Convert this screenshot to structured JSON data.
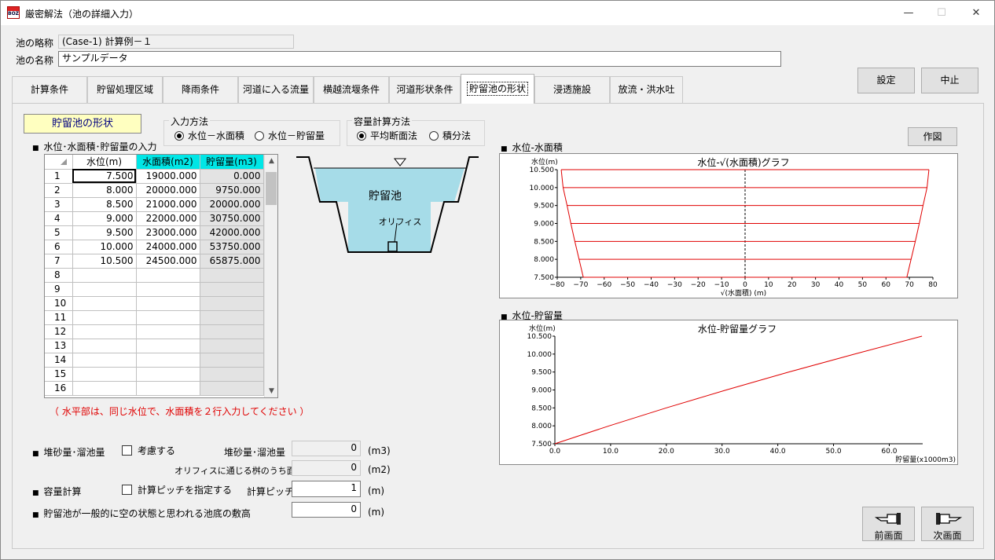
{
  "window": {
    "title": "厳密解法（池の詳細入力）",
    "app_icon_text": "BOZ",
    "minimize": "—",
    "maximize": "☐",
    "close": "✕"
  },
  "header": {
    "abbr_label": "池の略称",
    "abbr_value": "(Case-1) 計算例－１",
    "name_label": "池の名称",
    "name_value": "サンプルデータ",
    "settings_button": "設定",
    "cancel_button": "中止"
  },
  "tabs": [
    "計算条件",
    "貯留処理区域",
    "降雨条件",
    "河道に入る流量",
    "横越流堰条件",
    "河道形状条件",
    "貯留池の形状",
    "浸透施設",
    "放流・洪水吐"
  ],
  "active_tab": 6,
  "panel": {
    "section_label": "貯留池の形状",
    "input_method": {
      "title": "入力方法",
      "options": [
        "水位－水面積",
        "水位－貯留量"
      ],
      "selected": 0
    },
    "capacity_method": {
      "title": "容量計算方法",
      "options": [
        "平均断面法",
        "積分法"
      ],
      "selected": 0
    },
    "table_section": "水位･水面積･貯留量の入力",
    "table": {
      "headers": [
        "水位(m)",
        "水面積(m2)",
        "貯留量(m3)"
      ],
      "rows": [
        [
          "1",
          "7.500",
          "19000.000",
          "0.000"
        ],
        [
          "2",
          "8.000",
          "20000.000",
          "9750.000"
        ],
        [
          "3",
          "8.500",
          "21000.000",
          "20000.000"
        ],
        [
          "4",
          "9.000",
          "22000.000",
          "30750.000"
        ],
        [
          "5",
          "9.500",
          "23000.000",
          "42000.000"
        ],
        [
          "6",
          "10.000",
          "24000.000",
          "53750.000"
        ],
        [
          "7",
          "10.500",
          "24500.000",
          "65875.000"
        ],
        [
          "8",
          "",
          "",
          ""
        ],
        [
          "9",
          "",
          "",
          ""
        ],
        [
          "10",
          "",
          "",
          ""
        ],
        [
          "11",
          "",
          "",
          ""
        ],
        [
          "12",
          "",
          "",
          ""
        ],
        [
          "13",
          "",
          "",
          ""
        ],
        [
          "14",
          "",
          "",
          ""
        ],
        [
          "15",
          "",
          "",
          ""
        ],
        [
          "16",
          "",
          "",
          ""
        ]
      ]
    },
    "note": "（ 水平部は、同じ水位で、水面積を２行入力してください ）",
    "diagram": {
      "pond_label": "貯留池",
      "orifice_label": "オリフィス"
    },
    "sediment": {
      "label": "堆砂量･溜池量",
      "check_label": "考慮する",
      "value_label": "堆砂量･溜池量",
      "value": "0",
      "unit": "(m3)",
      "orifice_area_label": "オリフィスに通じる桝のうち面積",
      "orifice_area_value": "0",
      "orifice_area_unit": "(m2)"
    },
    "capacity_calc": {
      "label": "容量計算",
      "check_label": "計算ピッチを指定する",
      "pitch_label": "計算ピッチ",
      "pitch_value": "1",
      "unit": "(m)"
    },
    "bottom_elev": {
      "label": "貯留池が一般的に空の状態と思われる池底の敷高",
      "value": "0",
      "unit": "(m)"
    },
    "draw_button": "作図",
    "prev_button": "前画面",
    "next_button": "次画面"
  },
  "chart_data": [
    {
      "type": "line",
      "section_title": "水位-水面積",
      "title": "水位-√(水面積)グラフ",
      "ylabel": "水位(m)",
      "xlabel": "√(水面積) (m)",
      "xlim": [
        -80,
        80
      ],
      "ylim": [
        7.5,
        10.5
      ],
      "x_ticks": [
        "−80",
        "−70",
        "−60",
        "−50",
        "−40",
        "−30",
        "−20",
        "−10",
        "0",
        "10",
        "20",
        "30",
        "40",
        "50",
        "60",
        "70",
        "80"
      ],
      "y_ticks": [
        "7.500",
        "8.000",
        "8.500",
        "9.000",
        "9.500",
        "10.000",
        "10.500"
      ],
      "y": [
        7.5,
        8.0,
        8.5,
        9.0,
        9.5,
        10.0,
        10.5
      ],
      "x_right": [
        68.9,
        70.7,
        72.5,
        74.2,
        75.8,
        77.5,
        78.3
      ],
      "x_left": [
        -68.9,
        -70.7,
        -72.5,
        -74.2,
        -75.8,
        -77.5,
        -78.3
      ]
    },
    {
      "type": "line",
      "section_title": "水位-貯留量",
      "title": "水位-貯留量グラフ",
      "ylabel": "水位(m)",
      "xlabel": "貯留量(x1000m3)",
      "xlim": [
        0,
        66
      ],
      "ylim": [
        7.5,
        10.5
      ],
      "x_ticks": [
        "0.0",
        "10.0",
        "20.0",
        "30.0",
        "40.0",
        "50.0",
        "60.0"
      ],
      "y_ticks": [
        "7.500",
        "8.000",
        "8.500",
        "9.000",
        "9.500",
        "10.000",
        "10.500"
      ],
      "x": [
        0,
        9.75,
        20.0,
        30.75,
        42.0,
        53.75,
        65.875
      ],
      "y": [
        7.5,
        8.0,
        8.5,
        9.0,
        9.5,
        10.0,
        10.5
      ]
    }
  ]
}
